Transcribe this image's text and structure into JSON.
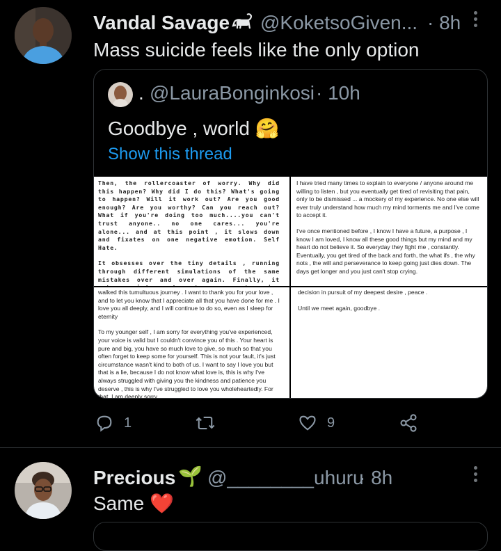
{
  "tweet1": {
    "name": "Vandal Savage",
    "handle": "@KoketsoGiven...",
    "time": "· 8h",
    "text": "Mass suicide feels like the only option",
    "quote": {
      "dot": ".",
      "handle": "@LauraBonginkosi",
      "time": "· 10h",
      "text": "Goodbye , world",
      "emoji": "🤗",
      "show_thread": "Show this thread",
      "page1": {
        "p1": "Then, the rollercoaster of worry. Why did this happen? Why did I do this? What's going to happen? Will it work out? Are you good enough? Are you worthy? Can you reach out? What if you're doing too much....you can't trust anyone.. no one cares... you're alone... and at this point , it slows down and fixates on one negative emotion. Self Hate.",
        "p2": "It obsesses over the tiny details , running through different simulations of the same mistakes over and over again. Finally, it acts as judge and sentences you to pain. Overwhelming, silent, emotional turmoil. Now, you are in a dark tunnel and you have to fight the unknown , unseen emotions to reach the little opening of light. Peace? Happiness ? Contentment? You never"
      },
      "page2": {
        "p1": "I have tried many times to explain to everyone / anyone around me willing to listen , but you eventually get tired of revisiting that pain, only to be dismissed ... a mockery of my experience. No one else will ever truly understand how much my mind torments me and I've come to accept it.",
        "p2": "I've once mentioned before , I know I have a future, a purpose , I know I am loved, I know all these good things but my mind and my heart do not believe it. So everyday they fight me , constantly. Eventually, you get tired of the back and forth, the what ifs , the why nots , the will and perseverance to keep going just dies down. The days get longer and you just can't stop crying."
      },
      "page3": {
        "p1": "walked this tumultuous journey . I want to thank you for your love , and to let you know that I appreciate all that you have done for me . I love you all deeply, and I will continue to do so, even as I sleep for eternity",
        "p2": "To my younger self , I am sorry for everything you've experienced, your voice is valid but I couldn't convince you of this . Your heart is pure and big, you have so much love to give, so much so that you often forget to keep some for yourself. This is not your fault, it's just circumstance wasn't kind to both of us. I want to say I love you but that is a lie, because I do not know what love is, this is why I've always struggled with giving you the kindness and patience you deserve , this is why I've struggled to love you wholeheartedly. For that, I am deeply sorry."
      },
      "page4": {
        "p1": "decision in pursuit of my deepest desire , peace .",
        "p2": "Until we meet again, goodbye ."
      }
    },
    "actions": {
      "replies": "1",
      "likes": "9"
    }
  },
  "tweet2": {
    "name": "Precious",
    "emoji": "🌱",
    "handle": "@________uhuru",
    "time": "· 8h",
    "text": "Same",
    "heart": "❤️"
  },
  "colors": {
    "background": "#000000",
    "text": "#e7e9ea",
    "muted": "#8b98a5",
    "link": "#1d9bf0",
    "heart": "#f91880"
  }
}
